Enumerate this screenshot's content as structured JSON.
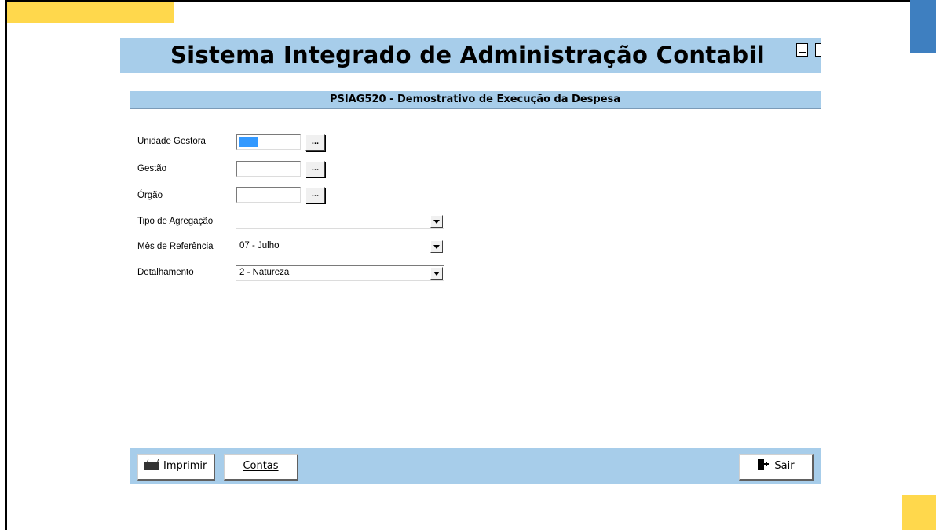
{
  "app": {
    "title": "Sistema Integrado de Administração Contabil",
    "subtitle": "PSIAG520 - Demostrativo de Execução da Despesa"
  },
  "form": {
    "unidade_gestora": {
      "label": "Unidade Gestora",
      "value": "",
      "lookup_label": "..."
    },
    "gestao": {
      "label": "Gestão",
      "value": "",
      "lookup_label": "..."
    },
    "orgao": {
      "label": "Órgão",
      "value": "",
      "lookup_label": "..."
    },
    "tipo_agregacao": {
      "label": "Tipo de Agregação",
      "value": ""
    },
    "mes_referencia": {
      "label": "Mês de Referência",
      "value": "07 - Julho"
    },
    "detalhamento": {
      "label": "Detalhamento",
      "value": "2 - Natureza"
    }
  },
  "footer": {
    "print_label": "Imprimir",
    "contas_label": "Contas",
    "exit_label": "Sair"
  },
  "icons": {
    "print": "printer-icon",
    "exit": "exit-door-icon",
    "dropdown": "chevron-down-icon"
  },
  "colors": {
    "header_bg": "#a7cdea",
    "accent_yellow": "#ffd84c",
    "accent_blue": "#3e7fc0",
    "selection": "#3399ff"
  }
}
